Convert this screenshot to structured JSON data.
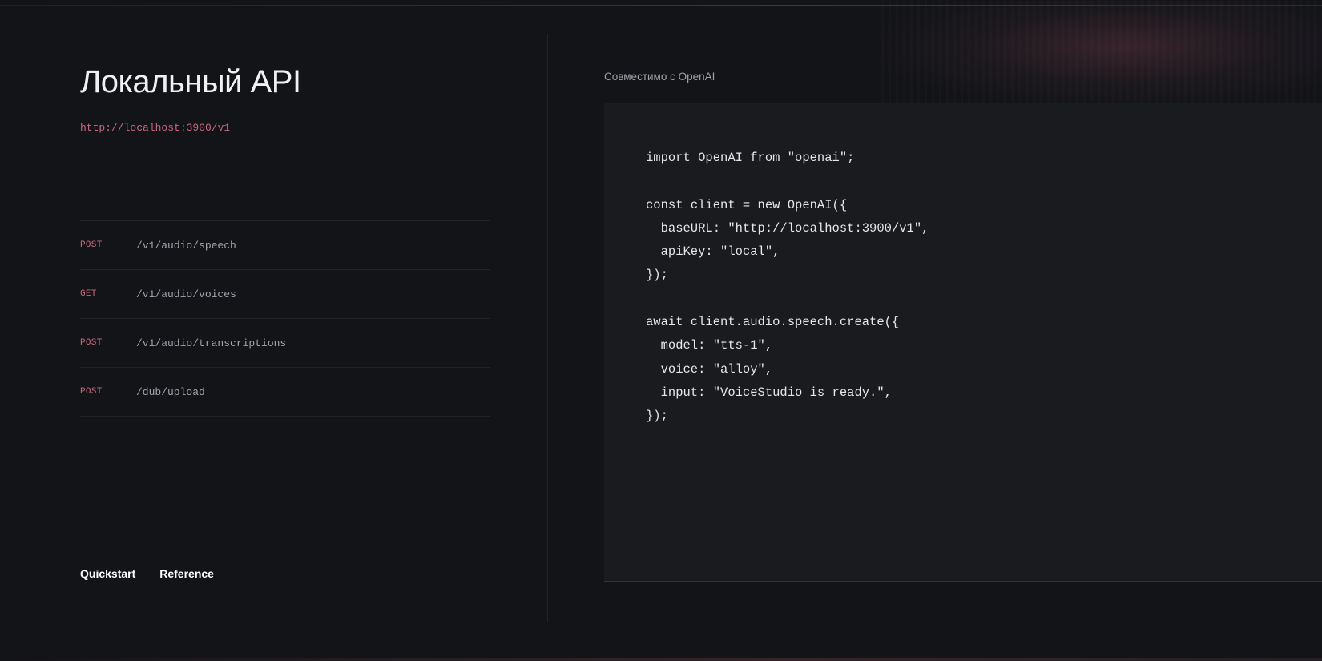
{
  "header": {
    "title": "Локальный API",
    "base_url": "http://localhost:3900/v1"
  },
  "endpoints": [
    {
      "method": "POST",
      "path": "/v1/audio/speech"
    },
    {
      "method": "GET",
      "path": "/v1/audio/voices"
    },
    {
      "method": "POST",
      "path": "/v1/audio/transcriptions"
    },
    {
      "method": "POST",
      "path": "/dub/upload"
    }
  ],
  "footer": {
    "quickstart_label": "Quickstart",
    "reference_label": "Reference"
  },
  "code": {
    "compat_label": "Совместимо с OpenAI",
    "lines": [
      "import OpenAI from \"openai\";",
      "",
      "const client = new OpenAI({",
      "  baseURL: \"http://localhost:3900/v1\",",
      "  apiKey: \"local\",",
      "});",
      "",
      "await client.audio.speech.create({",
      "  model: \"tts-1\",",
      "  voice: \"alloy\",",
      "  input: \"VoiceStudio is ready.\",",
      "});"
    ]
  },
  "colors": {
    "background": "#131418",
    "accent": "#c9697d",
    "code_panel": "#1a1b1f"
  }
}
